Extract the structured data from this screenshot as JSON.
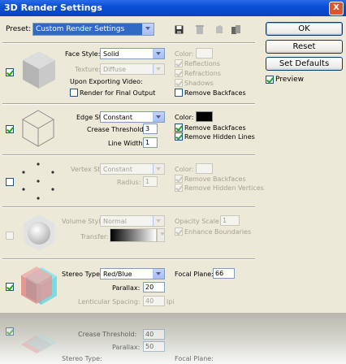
{
  "window": {
    "title": "3D Render Settings",
    "close_symbol": "X"
  },
  "preset": {
    "label": "Preset:",
    "value": "Custom Render Settings",
    "icons": [
      "save-preset-icon",
      "delete-preset-icon",
      "load-preset-icon",
      "duplicate-preset-icon"
    ]
  },
  "buttons": {
    "ok": "OK",
    "reset": "Reset",
    "set_defaults": "Set Defaults"
  },
  "preview": {
    "label": "Preview",
    "checked": true
  },
  "face": {
    "enabled": true,
    "style_label": "Face Style:",
    "style_value": "Solid",
    "texture_label": "Texture:",
    "texture_value": "Diffuse",
    "exporting_label": "Upon Exporting Video:",
    "render_final_label": "Render for Final Output",
    "render_final_checked": false,
    "color_label": "Color:",
    "reflections": "Reflections",
    "refractions": "Refractions",
    "shadows": "Shadows",
    "remove_backfaces": "Remove Backfaces",
    "remove_backfaces_checked": false
  },
  "edge": {
    "enabled": true,
    "style_label": "Edge Style:",
    "style_value": "Constant",
    "crease_label": "Crease Threshold:",
    "crease_value": "3",
    "width_label": "Line Width:",
    "width_value": "1",
    "color_label": "Color:",
    "color": "#000000",
    "remove_backfaces": "Remove Backfaces",
    "remove_backfaces_checked": true,
    "remove_hidden": "Remove Hidden Lines",
    "remove_hidden_checked": true
  },
  "vertex": {
    "enabled": false,
    "style_label": "Vertex Style:",
    "style_value": "Constant",
    "radius_label": "Radius:",
    "radius_value": "1",
    "color_label": "Color:",
    "remove_backfaces": "Remove Backfaces",
    "remove_hidden": "Remove Hidden Vertices"
  },
  "volume": {
    "enabled": false,
    "style_label": "Volume Style:",
    "style_value": "Normal",
    "transfer_label": "Transfer:",
    "opacity_label": "Opacity Scale:",
    "opacity_value": "1",
    "enhance_label": "Enhance Boundaries"
  },
  "stereo": {
    "enabled": true,
    "type_label": "Stereo Type:",
    "type_value": "Red/Blue",
    "parallax_label": "Parallax:",
    "parallax_value": "20",
    "lenticular_label": "Lenticular Spacing:",
    "lenticular_value": "40",
    "lenticular_unit": "lpi",
    "focal_label": "Focal Plane:",
    "focal_value": "66"
  },
  "reflection": {
    "parallax_label": "Parallax:",
    "parallax_value": "50",
    "stereo_label": "Stereo Type:",
    "focal_label": "Focal Plane:",
    "threshold_label": "Crease Threshold:",
    "threshold_value": "40"
  },
  "colors": {
    "title_bar": "#0a4fd6",
    "dialog_bg": "#ece9d8",
    "check_green": "#21a121"
  }
}
